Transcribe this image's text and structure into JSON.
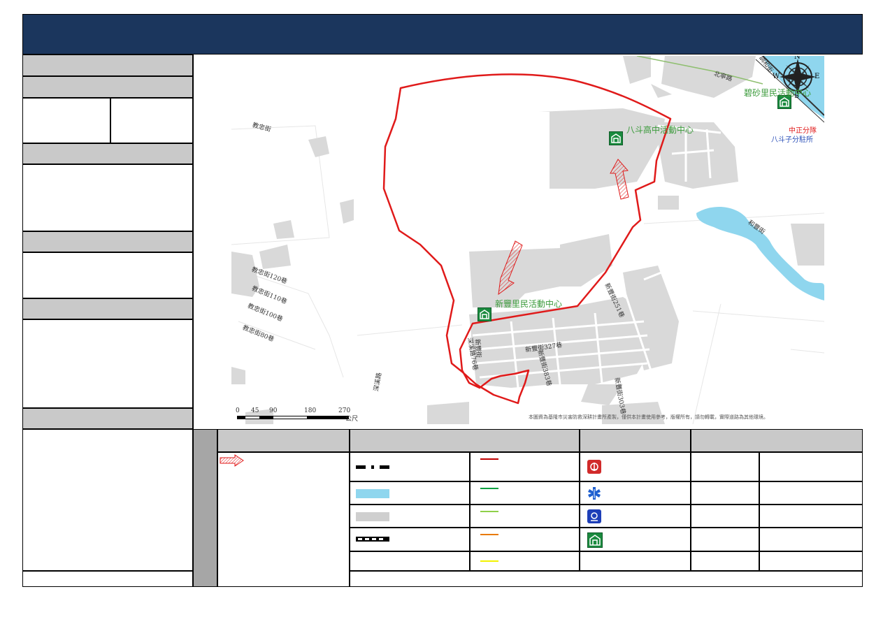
{
  "map": {
    "labels": {
      "center_north": "八斗高中活動中心",
      "center_south": "新豐里民活動中心",
      "center_ne": "碧砂里民活動中心",
      "police": "中正分隊",
      "police_post": "八斗子分駐所"
    },
    "roads": [
      {
        "text": "北寧路"
      },
      {
        "text": "調和街"
      },
      {
        "text": "和豐街"
      },
      {
        "text": "新豐街"
      },
      {
        "text": "新豐街251巷"
      },
      {
        "text": "新豐街327巷"
      },
      {
        "text": "新豐街303巷"
      },
      {
        "text": "新豐街383巷"
      },
      {
        "text": "深溪路76巷"
      },
      {
        "text": "深溪路"
      },
      {
        "text": "教忠街"
      },
      {
        "text": "教忠街120巷"
      },
      {
        "text": "教忠街110巷"
      },
      {
        "text": "教忠街100巷"
      },
      {
        "text": "教忠街80巷"
      }
    ],
    "compass": {
      "n": "N",
      "s": "S",
      "w": "W",
      "e": "E"
    },
    "scale": {
      "ticks": [
        "0",
        "45",
        "90",
        "180",
        "270"
      ],
      "unit": "公尺"
    },
    "disclaimer": "本圖資為基隆市災害防救深耕計畫所產製，僅供本計畫使用參考，版權所有，請勿轉載，實際道路為其他環境。"
  },
  "colors": {
    "header": "#1b365d",
    "boundary": "#e01a1a",
    "water": "#8fd6ee",
    "building": "#d9d9d9",
    "panel": "#c9c9c9",
    "legend_lines": [
      "#c00000",
      "#00a040",
      "#8fd04a",
      "#e87a00",
      "#f2f200"
    ]
  },
  "legend": {
    "icons": [
      "fire-station-icon",
      "ambulance-icon",
      "police-icon",
      "shelter-icon"
    ]
  }
}
